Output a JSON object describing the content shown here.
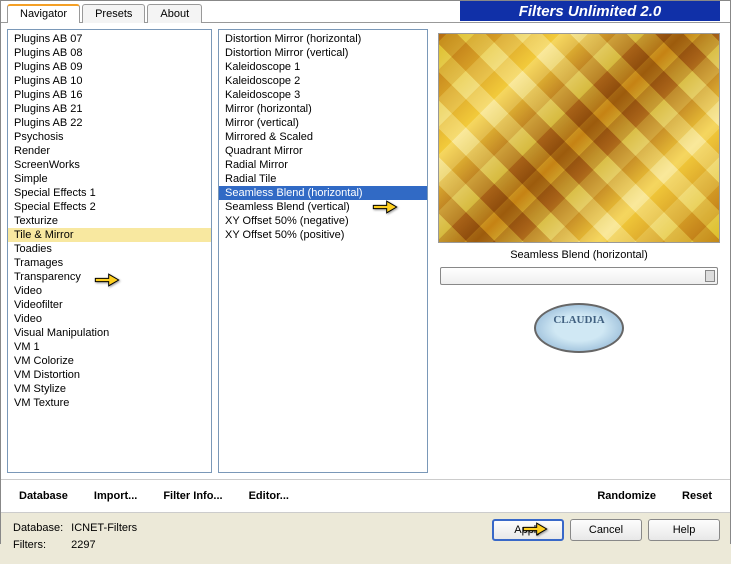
{
  "app_title": "Filters Unlimited 2.0",
  "tabs": [
    "Navigator",
    "Presets",
    "About"
  ],
  "active_tab": 0,
  "categories": {
    "items": [
      "Plugins AB 07",
      "Plugins AB 08",
      "Plugins AB 09",
      "Plugins AB 10",
      "Plugins AB 16",
      "Plugins AB 21",
      "Plugins AB 22",
      "Psychosis",
      "Render",
      "ScreenWorks",
      "Simple",
      "Special Effects 1",
      "Special Effects 2",
      "Texturize",
      "Tile & Mirror",
      "Toadies",
      "Tramages",
      "Transparency",
      "Video",
      "Videofilter",
      "Video",
      "Visual Manipulation",
      "VM 1",
      "VM Colorize",
      "VM Distortion",
      "VM Stylize",
      "VM Texture"
    ],
    "selected": "Tile & Mirror"
  },
  "filters": {
    "items": [
      "Distortion Mirror (horizontal)",
      "Distortion Mirror (vertical)",
      "Kaleidoscope 1",
      "Kaleidoscope 2",
      "Kaleidoscope 3",
      "Mirror (horizontal)",
      "Mirror (vertical)",
      "Mirrored & Scaled",
      "Quadrant Mirror",
      "Radial Mirror",
      "Radial Tile",
      "Seamless Blend (horizontal)",
      "Seamless Blend (vertical)",
      "XY Offset 50% (negative)",
      "XY Offset 50% (positive)"
    ],
    "selected": "Seamless Blend (horizontal)"
  },
  "preview": {
    "label": "Seamless Blend (horizontal)"
  },
  "toolbar": {
    "database": "Database",
    "import": "Import...",
    "filter_info": "Filter Info...",
    "editor": "Editor...",
    "randomize": "Randomize",
    "reset": "Reset"
  },
  "footer": {
    "db_label": "Database:",
    "db_value": "ICNET-Filters",
    "filters_label": "Filters:",
    "filters_value": "2297",
    "apply": "Apply",
    "cancel": "Cancel",
    "help": "Help"
  },
  "logo_text": "CLAUDIA"
}
